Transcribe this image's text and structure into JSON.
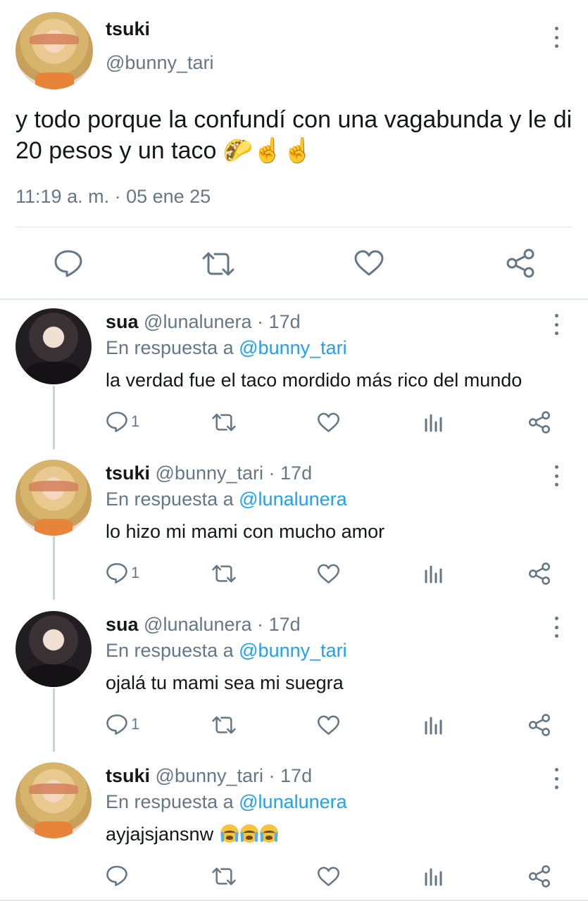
{
  "main_tweet": {
    "display_name": "tsuki",
    "handle": "@bunny_tari",
    "text": "y todo porque la confundí con una vagabunda y le di 20 pesos y un taco 🌮☝️☝️",
    "timestamp": "11:19 a. m. · 05 ene 25",
    "actions": [
      "reply-icon",
      "retweet-icon",
      "like-icon",
      "share-icon"
    ]
  },
  "replies": [
    {
      "display_name": "sua",
      "meta": "@lunalunera · 17d",
      "reply_prefix": "En respuesta a",
      "reply_to": "@bunny_tari",
      "text": "la verdad fue el taco mordido más rico del mundo",
      "reply_count": "1"
    },
    {
      "display_name": "tsuki",
      "meta": "@bunny_tari · 17d",
      "reply_prefix": "En respuesta a",
      "reply_to": "@lunalunera",
      "text": "lo hizo mi mami con mucho amor",
      "reply_count": "1"
    },
    {
      "display_name": "sua",
      "meta": "@lunalunera · 17d",
      "reply_prefix": "En respuesta a",
      "reply_to": "@bunny_tari",
      "text": "ojalá tu mami sea mi suegra",
      "reply_count": "1"
    },
    {
      "display_name": "tsuki",
      "meta": "@bunny_tari · 17d",
      "reply_prefix": "En respuesta a",
      "reply_to": "@lunalunera",
      "text": "ayjajsjansnw",
      "text_emoji": "😭😭😭",
      "reply_count": ""
    }
  ],
  "colors": {
    "accent": "#1da1f2",
    "secondary_text": "#657786",
    "divider": "#e1e8ed"
  }
}
